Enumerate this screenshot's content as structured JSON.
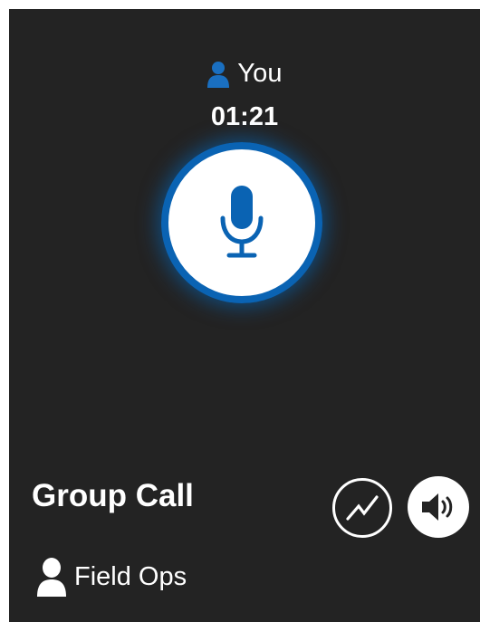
{
  "call": {
    "speaker_name": "You",
    "timer": "01:21",
    "group_title": "Group Call",
    "channel_name": "Field Ops"
  },
  "icons": {
    "speaker_avatar": "person-icon",
    "mic": "microphone-icon",
    "signal": "signal-quality-icon",
    "speaker": "speaker-volume-icon",
    "channel_avatar": "person-icon"
  },
  "colors": {
    "background": "#232323",
    "accent": "#0a63b3",
    "text": "#ffffff"
  }
}
